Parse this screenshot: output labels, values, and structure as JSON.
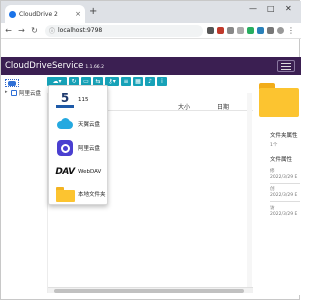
{
  "browser": {
    "tab_title": "CloudDrive 2",
    "tab_close": "×",
    "new_tab": "+",
    "win_min": "—",
    "win_max": "□",
    "win_close": "✕",
    "back": "←",
    "forward": "→",
    "reload": "↻",
    "url": "localhost:9798",
    "menu_dots": "⋮"
  },
  "app": {
    "title": "CloudDriveService",
    "version": "1.1.66.2",
    "accent": "#3b1f52",
    "toolbar_color": "#17a2b8"
  },
  "sidebar": {
    "tree_items": [
      {
        "label": "阿里云盘"
      }
    ]
  },
  "toolbar": {
    "buttons": [
      {
        "icon": "cloud-icon",
        "glyph": "☁▾"
      },
      {
        "icon": "refresh-icon",
        "glyph": "↻"
      },
      {
        "icon": "monitor-icon",
        "glyph": "▭"
      },
      {
        "icon": "swap-icon",
        "glyph": "⇆"
      },
      {
        "icon": "key-icon",
        "glyph": "⚷▾"
      },
      {
        "icon": "list-icon",
        "glyph": "≡"
      },
      {
        "icon": "grid-icon",
        "glyph": "▦"
      },
      {
        "icon": "bell-icon",
        "glyph": "♪"
      },
      {
        "icon": "info-icon",
        "glyph": "i"
      }
    ]
  },
  "dropdown": {
    "items": [
      {
        "label": "115",
        "logo_text": "5"
      },
      {
        "label": "天翼云盘"
      },
      {
        "label": "阿里云盘"
      },
      {
        "label": "WebDAV",
        "logo_text": "DAV"
      },
      {
        "label": "本地文件夹"
      }
    ]
  },
  "file_list": {
    "columns": {
      "size": "大小",
      "date": "日期"
    }
  },
  "properties": {
    "folder_props_title": "文件夹属性",
    "folder_count": "1个",
    "file_props_title": "文件属性",
    "fields": [
      {
        "label": "修",
        "value": "2022/3/29 E"
      },
      {
        "label": "创",
        "value": "2022/3/29 E"
      },
      {
        "label": "访",
        "value": "2022/3/29 E"
      }
    ]
  }
}
